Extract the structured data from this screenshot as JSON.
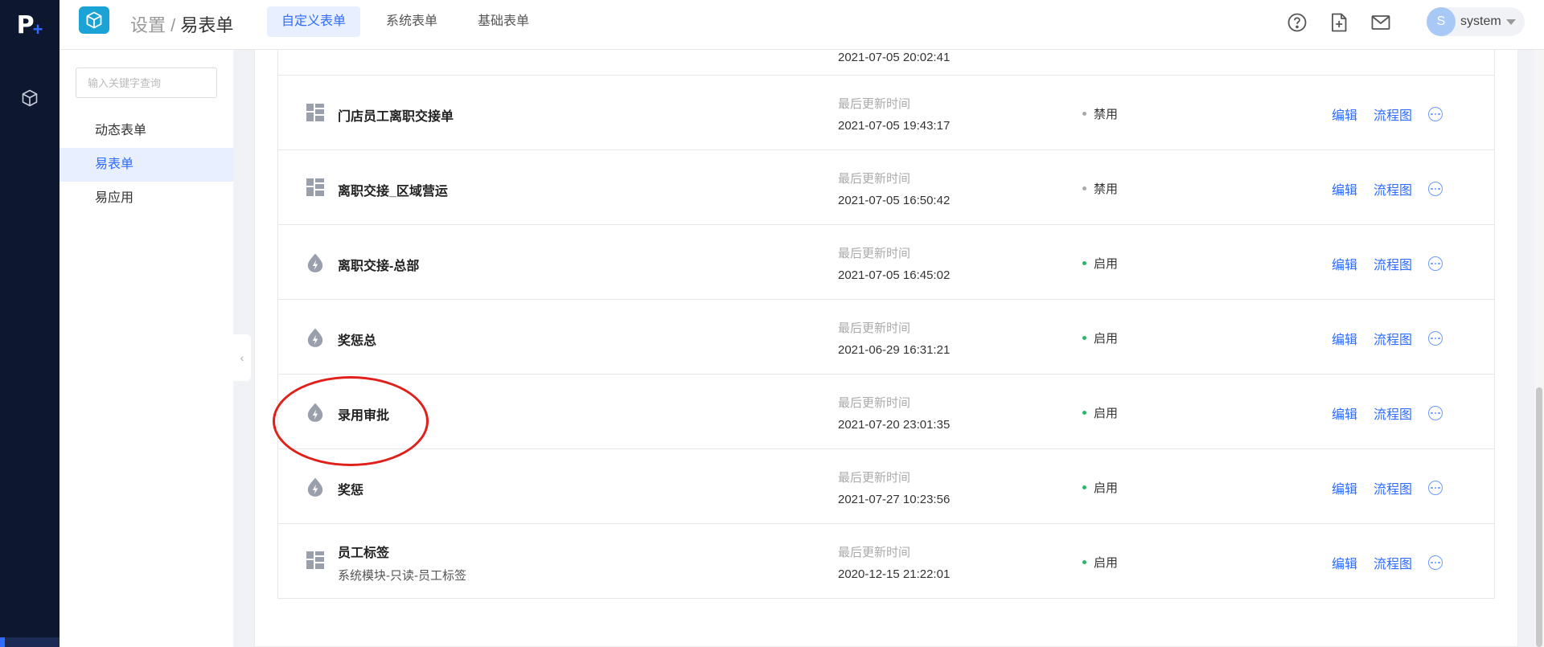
{
  "rail": {
    "logo_letter": "P",
    "logo_plus": "+",
    "nav_icon": "cube-icon"
  },
  "header": {
    "app_icon": "cube-icon",
    "breadcrumb_parent": "设置",
    "breadcrumb_sep": " / ",
    "breadcrumb_current": "易表单",
    "tabs": [
      {
        "label": "自定义表单",
        "active": true
      },
      {
        "label": "系统表单",
        "active": false
      },
      {
        "label": "基础表单",
        "active": false
      }
    ],
    "icons": [
      "help-icon",
      "new-document-icon",
      "mail-icon"
    ],
    "user": {
      "avatar_letter": "S",
      "name": "system"
    }
  },
  "sidebar": {
    "search_placeholder": "输入关键字查询",
    "items": [
      {
        "label": "动态表单",
        "active": false
      },
      {
        "label": "易表单",
        "active": true
      },
      {
        "label": "易应用",
        "active": false
      }
    ]
  },
  "list": {
    "partial_row_time": "2021-07-05 20:02:41",
    "time_label": "最后更新时间",
    "edit_label": "编辑",
    "flow_label": "流程图",
    "rows": [
      {
        "icon": "grid-icon",
        "name": "门店员工离职交接单",
        "subtitle": "",
        "time": "2021-07-05 19:43:17",
        "status": "禁用",
        "status_color": "#aaaaaa"
      },
      {
        "icon": "grid-icon",
        "name": "离职交接_区域营运",
        "subtitle": "",
        "time": "2021-07-05 16:50:42",
        "status": "禁用",
        "status_color": "#aaaaaa"
      },
      {
        "icon": "flash-drop-icon",
        "name": "离职交接-总部",
        "subtitle": "",
        "time": "2021-07-05 16:45:02",
        "status": "启用",
        "status_color": "#2fb36b"
      },
      {
        "icon": "flash-drop-icon",
        "name": "奖惩总",
        "subtitle": "",
        "time": "2021-06-29 16:31:21",
        "status": "启用",
        "status_color": "#2fb36b"
      },
      {
        "icon": "flash-drop-icon",
        "name": "录用审批",
        "subtitle": "",
        "time": "2021-07-20 23:01:35",
        "status": "启用",
        "status_color": "#2fb36b"
      },
      {
        "icon": "flash-drop-icon",
        "name": "奖惩",
        "subtitle": "",
        "time": "2021-07-27 10:23:56",
        "status": "启用",
        "status_color": "#2fb36b"
      },
      {
        "icon": "grid-icon",
        "name": "员工标签",
        "subtitle": "系统模块-只读-员工标签",
        "time": "2020-12-15 21:22:01",
        "status": "启用",
        "status_color": "#2fb36b"
      }
    ]
  },
  "colors": {
    "accent": "#2f6bff",
    "rail": "#0e1730",
    "annotation": "#e0201a"
  }
}
